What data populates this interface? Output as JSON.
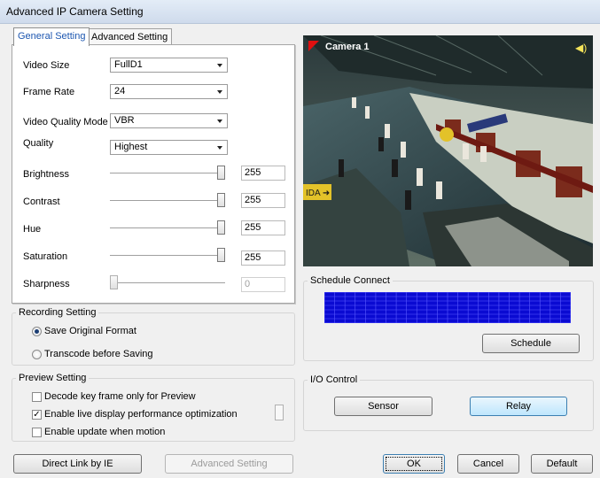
{
  "window": {
    "title": "Advanced IP Camera Setting"
  },
  "tabs": [
    {
      "label": "General Setting",
      "active": true
    },
    {
      "label": "Advanced Setting",
      "active": false
    }
  ],
  "general": {
    "video_size": {
      "label": "Video Size",
      "value": "FullD1"
    },
    "frame_rate": {
      "label": "Frame Rate",
      "value": "24"
    },
    "video_quality_mode": {
      "label": "Video Quality Mode",
      "value": "VBR"
    },
    "quality": {
      "label": "Quality",
      "value": "Highest"
    },
    "sliders": [
      {
        "label": "Brightness",
        "value": "255",
        "level": 1.0,
        "enabled": true
      },
      {
        "label": "Contrast",
        "value": "255",
        "level": 1.0,
        "enabled": true
      },
      {
        "label": "Hue",
        "value": "255",
        "level": 1.0,
        "enabled": true
      },
      {
        "label": "Saturation",
        "value": "255",
        "level": 1.0,
        "enabled": true
      },
      {
        "label": "Sharpness",
        "value": "0",
        "level": 0.0,
        "enabled": false
      }
    ]
  },
  "recording": {
    "title": "Recording Setting",
    "options": [
      {
        "label": "Save Original Format",
        "selected": true
      },
      {
        "label": "Transcode before Saving",
        "selected": false
      }
    ]
  },
  "preview": {
    "title": "Preview Setting",
    "options": [
      {
        "label": "Decode key frame only for Preview",
        "checked": false
      },
      {
        "label": "Enable live display performance optimization",
        "checked": true
      },
      {
        "label": "Enable update when motion",
        "checked": false
      }
    ]
  },
  "camera": {
    "name": "Camera 1"
  },
  "schedule": {
    "title": "Schedule Connect",
    "button": "Schedule",
    "grid_color": "#0a0ad2"
  },
  "io": {
    "title": "I/O Control",
    "sensor": "Sensor",
    "relay": "Relay"
  },
  "buttons": {
    "direct_link": "Direct Link by IE",
    "advanced": "Advanced Setting",
    "ok": "OK",
    "cancel": "Cancel",
    "default": "Default"
  }
}
